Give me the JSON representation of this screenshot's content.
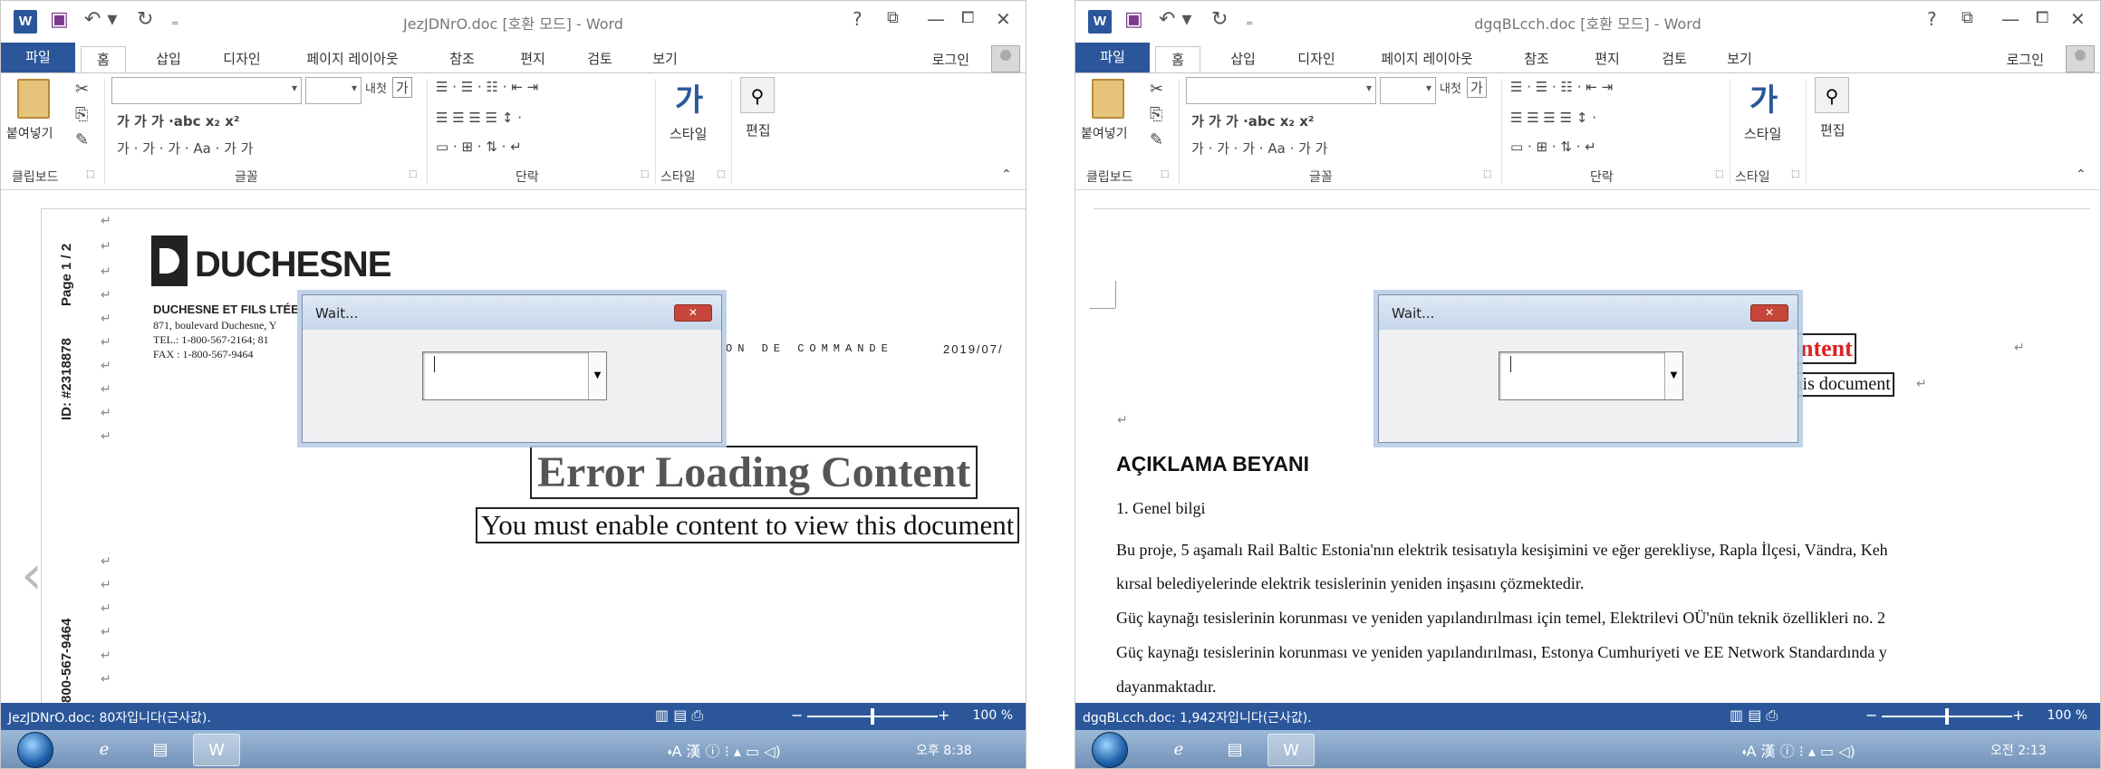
{
  "common": {
    "app_icon": "W",
    "qa_save": "▣",
    "qa_undo": "↶ ▾",
    "qa_redo": "↻",
    "qa_customize": "₌",
    "help": "?",
    "restore_ribbon": "⧉",
    "minimize": "—",
    "maximize": "⧠",
    "close": "✕",
    "tabs": [
      "파일",
      "홈",
      "삽입",
      "디자인",
      "페이지 레이아웃",
      "참조",
      "편지",
      "검토",
      "보기"
    ],
    "login": "로그인",
    "ribbon": {
      "paste_label": "붙여넣기",
      "clipboard": "클립보드",
      "font": "글꼴",
      "paragraph": "단락",
      "styles": "스타일",
      "style_big_label": "스타일",
      "edit": "편집",
      "style_glyph": "가",
      "binocular": "⚲",
      "font_row1": "가  가  가  ·abc  x₂  x²",
      "font_row2": "가 · 가 · 가 · Aa ·  가  가",
      "para_row1": "☰ ·  ☰ ·  ☷ ·   ⇤  ⇥",
      "para_row2": "☰  ☰  ☰  ☰   ↕ ·",
      "para_row3": "▭ ·  ⊞ ·    ⇅ ·  ↵",
      "clip_icons": "✂ ⎘ ✎",
      "expand": "⬚"
    },
    "dialog_title": "Wait...",
    "dialog_close": "✕",
    "dialog_drop": "▼",
    "status_icons": "▥  ▤  ⎙",
    "zoom_minus": "−",
    "zoom_plus": "+",
    "zoom_pct": "100 %",
    "tray_icons": "⬪A 漢 ⓘ ⁝ ▴  ▭ ◁)",
    "paragraph_mark": "↵"
  },
  "left": {
    "title": "JezJDNrO.doc [호환 모드] - Word",
    "page_label": "Page 1 / 2",
    "id_label": "ID: #2318878",
    "phone_label": "800-567-9464",
    "logo_text": "DUCHESNE",
    "company": "DUCHESNE ET FILS LTÉE",
    "address": "871, boulevard Duchesne, Y",
    "tel": "TEL.: 1-800-567-2164; 81",
    "fax": "FAX : 1-800-567-9464",
    "bon": "ON DE COMMANDE",
    "date": "2019/07/",
    "error_title": "Error Loading Content",
    "error_sub": "You must enable content to view this document",
    "status": "JezJDNrO.doc: 80자입니다(근사값).",
    "clock": "오후 8:38"
  },
  "right": {
    "title": "dgqBLcch.doc [호환 모드] - Word",
    "err_title_partial": "ontent",
    "err_sub_partial": "this document",
    "heading": "AÇIKLAMA BEYANI",
    "subheading": "1. Genel bilgi",
    "para1a": "Bu proje, 5 aşamalı Rail Baltic Estonia'nın elektrik tesisatıyla kesişimini ve eğer gerekliyse, Rapla İlçesi, Vändra, Keh",
    "para1b": "kırsal belediyelerinde elektrik tesislerinin yeniden inşasını çözmektedir.",
    "para2": "Güç kaynağı tesislerinin korunması ve yeniden yapılandırılması için temel, Elektrilevi OÜ'nün teknik özellikleri no. 2",
    "para3a": "Güç kaynağı tesislerinin korunması ve yeniden yapılandırılması, Estonya Cumhuriyeti ve EE Network Standardında y",
    "para3b": "dayanmaktadır.",
    "status": "dgqBLcch.doc: 1,942자입니다(근사값).",
    "clock": "오전 2:13"
  }
}
